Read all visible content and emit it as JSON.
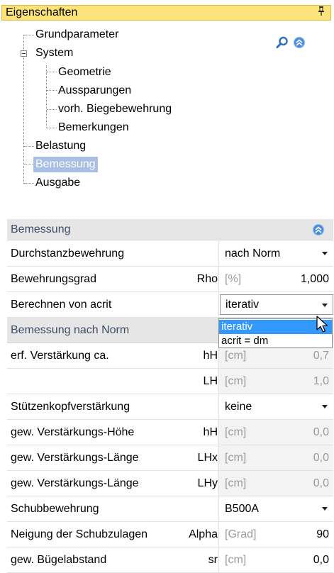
{
  "panel": {
    "title": "Eigenschaften",
    "pin_glyph": "$"
  },
  "tree": {
    "items": [
      {
        "label": "Grundparameter"
      },
      {
        "label": "System"
      },
      {
        "label": "Geometrie"
      },
      {
        "label": "Aussparungen"
      },
      {
        "label": "vorh. Biegebewehrung"
      },
      {
        "label": "Bemerkungen"
      },
      {
        "label": "Belastung"
      },
      {
        "label": "Bemessung"
      },
      {
        "label": "Ausgabe"
      }
    ]
  },
  "grid": {
    "section1": "Bemessung",
    "section2": "Bemessung nach Norm",
    "rows": [
      {
        "label": "Durchstanzbewehrung",
        "value": "nach Norm"
      },
      {
        "label": "Bewehrungsgrad",
        "symbol": "Rho",
        "unit": "[%]",
        "value": "1,000"
      },
      {
        "label": "Berechnen von acrit",
        "value": "iterativ"
      },
      {
        "label": "erf. Verstärkung ca.",
        "symbol": "hH",
        "unit": "[cm]",
        "value": "0,7"
      },
      {
        "label": "",
        "symbol": "LH",
        "unit": "[cm]",
        "value": "1,0"
      },
      {
        "label": "Stützenkopfverstärkung",
        "value": "keine"
      },
      {
        "label": "gew. Verstärkungs-Höhe",
        "symbol": "hH",
        "unit": "[cm]",
        "value": "0,0"
      },
      {
        "label": "gew. Verstärkungs-Länge",
        "symbol": "LHx",
        "unit": "[cm]",
        "value": "0,0"
      },
      {
        "label": "gew. Verstärkungs-Länge",
        "symbol": "LHy",
        "unit": "[cm]",
        "value": "0,0"
      },
      {
        "label": "Schubbewehrung",
        "value": "B500A"
      },
      {
        "label": "Neigung der Schubzulagen",
        "symbol": "Alpha",
        "unit": "[Grad]",
        "value": "90"
      },
      {
        "label": "gew. Bügelabstand",
        "symbol": "sr",
        "unit": "[cm]",
        "value": "0,0"
      }
    ]
  },
  "dropdown": {
    "options": [
      "iterativ",
      "acrit = dm"
    ],
    "highlighted": "iterativ"
  },
  "icons": {
    "search": "search-icon",
    "collapse": "collapse-chevrons-icon",
    "pin": "pin-icon"
  },
  "colors": {
    "title_bg": "#fde47a",
    "tree_selection": "#a9bfe6",
    "dropdown_highlight": "#3399ff",
    "section_bg": "#e6e6e6"
  }
}
